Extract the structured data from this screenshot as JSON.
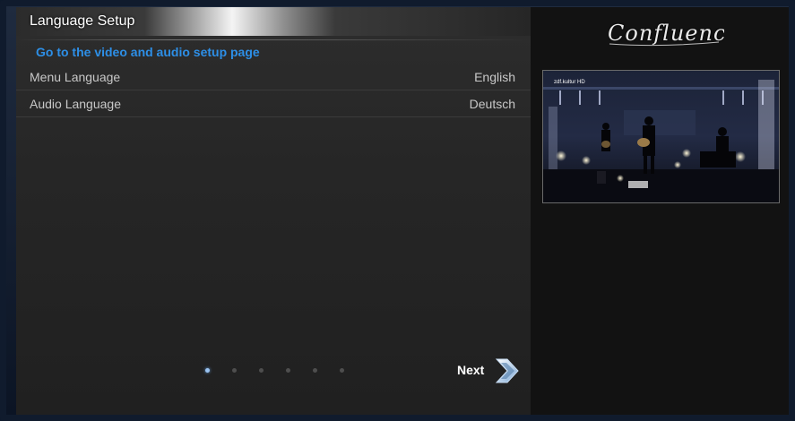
{
  "header": {
    "title": "Language Setup"
  },
  "main": {
    "link_text": "Go to the video and audio setup page",
    "settings": [
      {
        "label": "Menu Language",
        "value": "English"
      },
      {
        "label": "Audio Language",
        "value": "Deutsch"
      }
    ],
    "pager": {
      "count": 6,
      "active_index": 0
    },
    "next_label": "Next"
  },
  "sidebar": {
    "logo_text": "Confluence",
    "preview": {
      "channel_tag": "zdf.kultur HD"
    }
  },
  "icons": {
    "next": "chevron-right-icon"
  },
  "colors": {
    "link": "#2d8fe7",
    "active_dot": "#9bc3f0"
  }
}
